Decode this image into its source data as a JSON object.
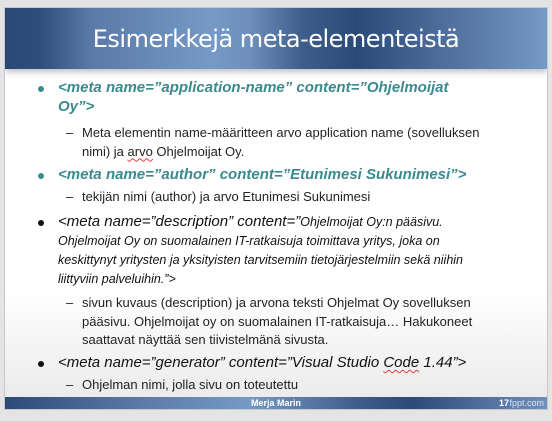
{
  "title": "Esimerkkejä meta-elementeistä",
  "bullets": [
    {
      "lines": [
        "<meta name=”application-name” content=”Ohjelmoijat",
        "Oy”>"
      ],
      "sub": {
        "line1": "Meta elementin name-määritteen arvo application name (sovelluksen",
        "line2a": "nimi) ja ",
        "line2b": "arvo",
        "line2c": " Ohjelmoijat Oy."
      }
    },
    {
      "lines": [
        "<meta name=”author” content=”Etunimesi Sukunimesi”>"
      ],
      "sub": {
        "line1": "tekijän nimi (author) ja arvo Etunimesi Sukunimesi"
      }
    },
    {
      "line1a": "<meta name=”description” content=”",
      "line1b": "Ohjelmoijat Oy:n pääsivu.",
      "lines": [
        "Ohjelmoijat Oy on suomalainen IT-ratkaisuja toimittava yritys, joka on",
        "keskittynyt yritysten ja yksityisten tarvitsemiin tietojärjestelmiin sekä niihin",
        "liittyviin palveluihin.”>"
      ],
      "sub": [
        "sivun kuvaus (description) ja arvona teksti Ohjelmat Oy sovelluksen",
        "pääsivu. Ohjelmoijat oy on suomalainen IT-ratkaisuja… Hakukoneet",
        "saattavat näyttää sen tiivistelmänä sivusta."
      ]
    },
    {
      "line_a": "<meta name=”generator” content=”Visual Studio ",
      "line_b": "Code",
      "line_c": " 1.44”>",
      "sub": "Ohjelman nimi, jolla sivu on toteutettu"
    }
  ],
  "footer": {
    "author": "Merja Marin",
    "page": "17",
    "site": "fppt.com"
  },
  "colors": {
    "accent": "#3a8a8e",
    "title_bg": "#2a4a78"
  }
}
